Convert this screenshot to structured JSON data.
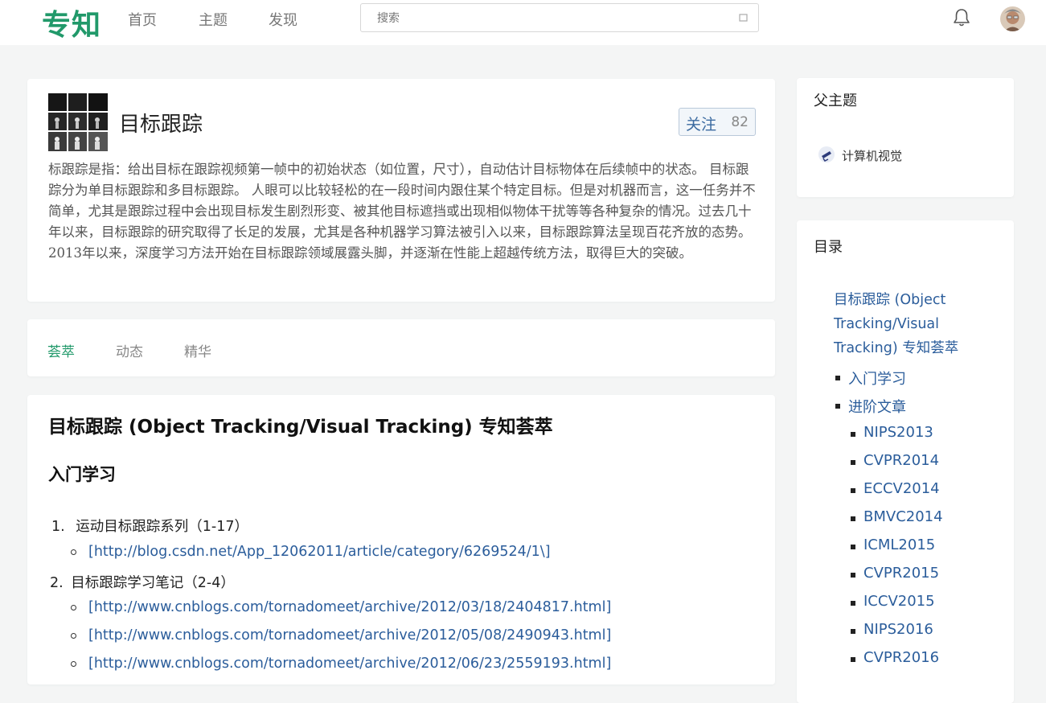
{
  "nav": {
    "logo": "专知",
    "links": [
      "首页",
      "主题",
      "发现"
    ],
    "search_placeholder": "搜索",
    "bell_icon": "bell-icon",
    "avatar_icon": "user-avatar"
  },
  "topic": {
    "title": "目标跟踪",
    "follow_label": "关注",
    "follow_count": "82",
    "description": "标跟踪是指：给出目标在跟踪视频第一帧中的初始状态（如位置，尺寸），自动估计目标物体在后续帧中的状态。 目标跟踪分为单目标跟踪和多目标跟踪。 人眼可以比较轻松的在一段时间内跟住某个特定目标。但是对机器而言，这一任务并不简单，尤其是跟踪过程中会出现目标发生剧烈形变、被其他目标遮挡或出现相似物体干扰等等各种复杂的情况。过去几十年以来，目标跟踪的研究取得了长足的发展，尤其是各种机器学习算法被引入以来，目标跟踪算法呈现百花齐放的态势。2013年以来，深度学习方法开始在目标跟踪领域展露头脚，并逐渐在性能上超越传统方法，取得巨大的突破。"
  },
  "tabs": [
    "荟萃",
    "动态",
    "精华"
  ],
  "article": {
    "title": "目标跟踪 (Object Tracking/Visual Tracking) 专知荟萃",
    "section": "入门学习",
    "items": [
      {
        "num": "1.",
        "text": "运动目标跟踪系列（1-17）"
      },
      {
        "num": "2.",
        "text": "目标跟踪学习笔记（2-4）"
      }
    ],
    "links": [
      "[http://blog.csdn.net/App_12062011/article/category/6269524/1\\]",
      "[http://www.cnblogs.com/tornadomeet/archive/2012/03/18/2404817.html]",
      "[http://www.cnblogs.com/tornadomeet/archive/2012/05/08/2490943.html]",
      "[http://www.cnblogs.com/tornadomeet/archive/2012/06/23/2559193.html]"
    ]
  },
  "parent_topics": {
    "heading": "父主题",
    "items": [
      "计算机视觉"
    ]
  },
  "toc": {
    "heading": "目录",
    "root": "目标跟踪 (Object Tracking/Visual Tracking) 专知荟萃",
    "level1": [
      "入门学习",
      "进阶文章"
    ],
    "level2": [
      "NIPS2013",
      "CVPR2014",
      "ECCV2014",
      "BMVC2014",
      "ICML2015",
      "CVPR2015",
      "ICCV2015",
      "NIPS2016",
      "CVPR2016"
    ]
  }
}
